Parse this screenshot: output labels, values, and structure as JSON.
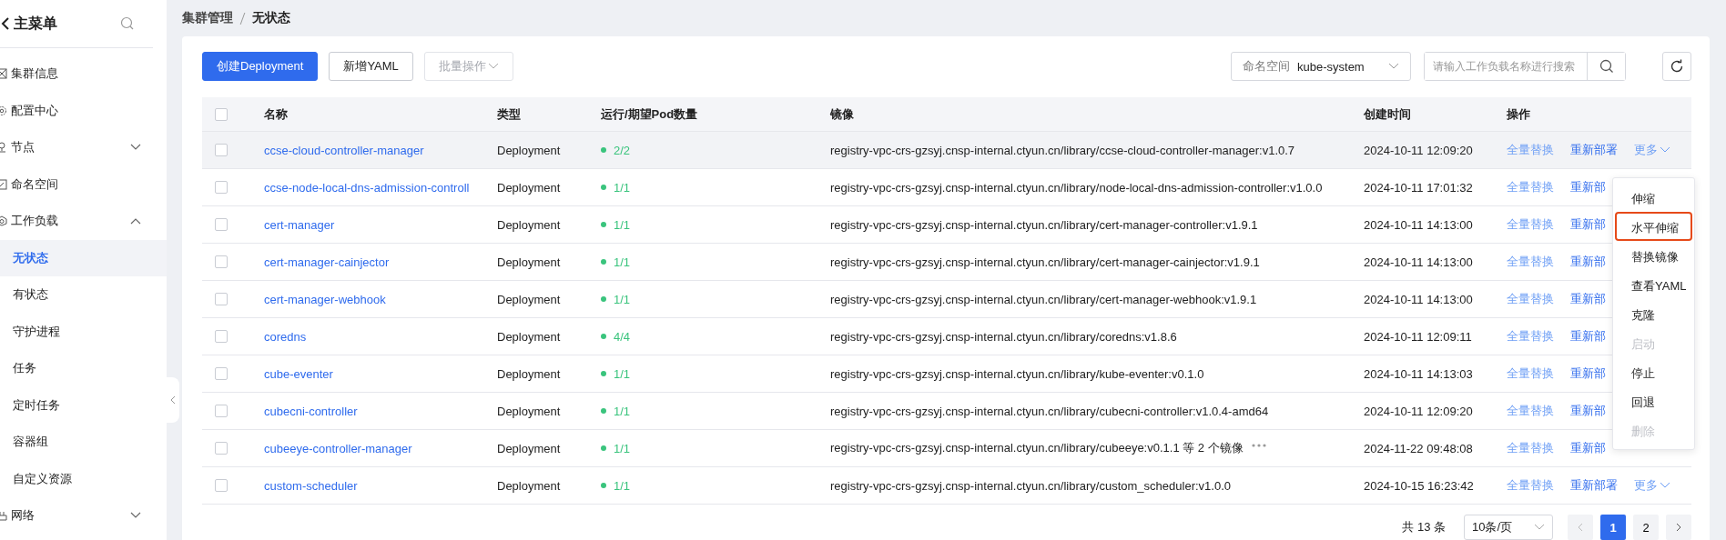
{
  "sidebar": {
    "title": "主菜单",
    "items": [
      {
        "label": "集群信息",
        "selected": false
      },
      {
        "label": "配置中心",
        "selected": false
      },
      {
        "label": "节点",
        "expanded": false,
        "selected": false
      },
      {
        "label": "命名空间",
        "selected": false
      },
      {
        "label": "工作负载",
        "expanded": true,
        "selected": false,
        "children": [
          {
            "label": "无状态",
            "selected": true
          },
          {
            "label": "有状态",
            "selected": false
          },
          {
            "label": "守护进程",
            "selected": false
          },
          {
            "label": "任务",
            "selected": false
          },
          {
            "label": "定时任务",
            "selected": false
          },
          {
            "label": "容器组",
            "selected": false
          },
          {
            "label": "自定义资源",
            "selected": false
          }
        ]
      },
      {
        "label": "网络",
        "expanded": false,
        "selected": false
      }
    ]
  },
  "breadcrumb": [
    "集群管理",
    "无状态"
  ],
  "toolbar": {
    "create": "创建Deployment",
    "add_yaml": "新增YAML",
    "batch": {
      "label": "批量操作",
      "disabled": true
    },
    "namespace": {
      "label": "命名空间",
      "value": "kube-system"
    },
    "search": {
      "placeholder": "请输入工作负载名称进行搜索"
    }
  },
  "table": {
    "columns": [
      "名称",
      "类型",
      "运行/期望Pod数量",
      "镜像",
      "创建时间",
      "操作"
    ],
    "header_checked": false,
    "rows": [
      {
        "checked": false,
        "hovered": true,
        "name": "ccse-cloud-controller-manager",
        "type": "Deployment",
        "pods": "2/2",
        "image": "registry-vpc-crs-gzsyj.cnsp-internal.ctyun.cn/library/ccse-cloud-controller-manager:v1.0.7",
        "created": "2024-10-11 12:09:20",
        "replace": "全量替换",
        "redeploy": "重新部署",
        "more": "更多"
      },
      {
        "checked": false,
        "hovered": false,
        "name": "ccse-node-local-dns-admission-controll",
        "type": "Deployment",
        "pods": "1/1",
        "image": "registry-vpc-crs-gzsyj.cnsp-internal.ctyun.cn/library/node-local-dns-admission-controller:v1.0.0",
        "created": "2024-10-11 17:01:32",
        "replace": "全量替换",
        "redeploy": "重新部"
      },
      {
        "checked": false,
        "hovered": false,
        "name": "cert-manager",
        "type": "Deployment",
        "pods": "1/1",
        "image": "registry-vpc-crs-gzsyj.cnsp-internal.ctyun.cn/library/cert-manager-controller:v1.9.1",
        "created": "2024-10-11 14:13:00",
        "replace": "全量替换",
        "redeploy": "重新部"
      },
      {
        "checked": false,
        "hovered": false,
        "name": "cert-manager-cainjector",
        "type": "Deployment",
        "pods": "1/1",
        "image": "registry-vpc-crs-gzsyj.cnsp-internal.ctyun.cn/library/cert-manager-cainjector:v1.9.1",
        "created": "2024-10-11 14:13:00",
        "replace": "全量替换",
        "redeploy": "重新部"
      },
      {
        "checked": false,
        "hovered": false,
        "name": "cert-manager-webhook",
        "type": "Deployment",
        "pods": "1/1",
        "image": "registry-vpc-crs-gzsyj.cnsp-internal.ctyun.cn/library/cert-manager-webhook:v1.9.1",
        "created": "2024-10-11 14:13:00",
        "replace": "全量替换",
        "redeploy": "重新部"
      },
      {
        "checked": false,
        "hovered": false,
        "name": "coredns",
        "type": "Deployment",
        "pods": "4/4",
        "image": "registry-vpc-crs-gzsyj.cnsp-internal.ctyun.cn/library/coredns:v1.8.6",
        "created": "2024-10-11 12:09:11",
        "replace": "全量替换",
        "redeploy": "重新部"
      },
      {
        "checked": false,
        "hovered": false,
        "name": "cube-eventer",
        "type": "Deployment",
        "pods": "1/1",
        "image": "registry-vpc-crs-gzsyj.cnsp-internal.ctyun.cn/library/kube-eventer:v0.1.0",
        "created": "2024-10-11 14:13:03",
        "replace": "全量替换",
        "redeploy": "重新部"
      },
      {
        "checked": false,
        "hovered": false,
        "name": "cubecni-controller",
        "type": "Deployment",
        "pods": "1/1",
        "image": "registry-vpc-crs-gzsyj.cnsp-internal.ctyun.cn/library/cubecni-controller:v1.0.4-amd64",
        "created": "2024-10-11 12:09:20",
        "replace": "全量替换",
        "redeploy": "重新部"
      },
      {
        "checked": false,
        "hovered": false,
        "name": "cubeeye-controller-manager",
        "type": "Deployment",
        "pods": "1/1",
        "image": "registry-vpc-crs-gzsyj.cnsp-internal.ctyun.cn/library/cubeeye:v0.1.1 等 2 个镜像",
        "image_more": true,
        "created": "2024-11-22 09:48:08",
        "replace": "全量替换",
        "redeploy": "重新部"
      },
      {
        "checked": false,
        "hovered": false,
        "name": "custom-scheduler",
        "type": "Deployment",
        "pods": "1/1",
        "image": "registry-vpc-crs-gzsyj.cnsp-internal.ctyun.cn/library/custom_scheduler:v1.0.0",
        "created": "2024-10-15 16:23:42",
        "replace": "全量替换",
        "redeploy": "重新部署",
        "more": "更多"
      }
    ]
  },
  "menu": [
    {
      "label": "伸缩",
      "disabled": false,
      "highlighted": false
    },
    {
      "label": "水平伸缩",
      "disabled": false,
      "highlighted": true
    },
    {
      "label": "替换镜像",
      "disabled": false,
      "highlighted": false
    },
    {
      "label": "查看YAML",
      "disabled": false,
      "highlighted": false
    },
    {
      "label": "克隆",
      "disabled": false,
      "highlighted": false
    },
    {
      "label": "启动",
      "disabled": true,
      "highlighted": false
    },
    {
      "label": "停止",
      "disabled": false,
      "highlighted": false
    },
    {
      "label": "回退",
      "disabled": false,
      "highlighted": false
    },
    {
      "label": "删除",
      "disabled": true,
      "highlighted": false
    }
  ],
  "pagination": {
    "total": "共 13 条",
    "page_size": "10条/页",
    "pages": [
      {
        "label": "1",
        "selected": true
      },
      {
        "label": "2",
        "selected": false
      }
    ]
  }
}
